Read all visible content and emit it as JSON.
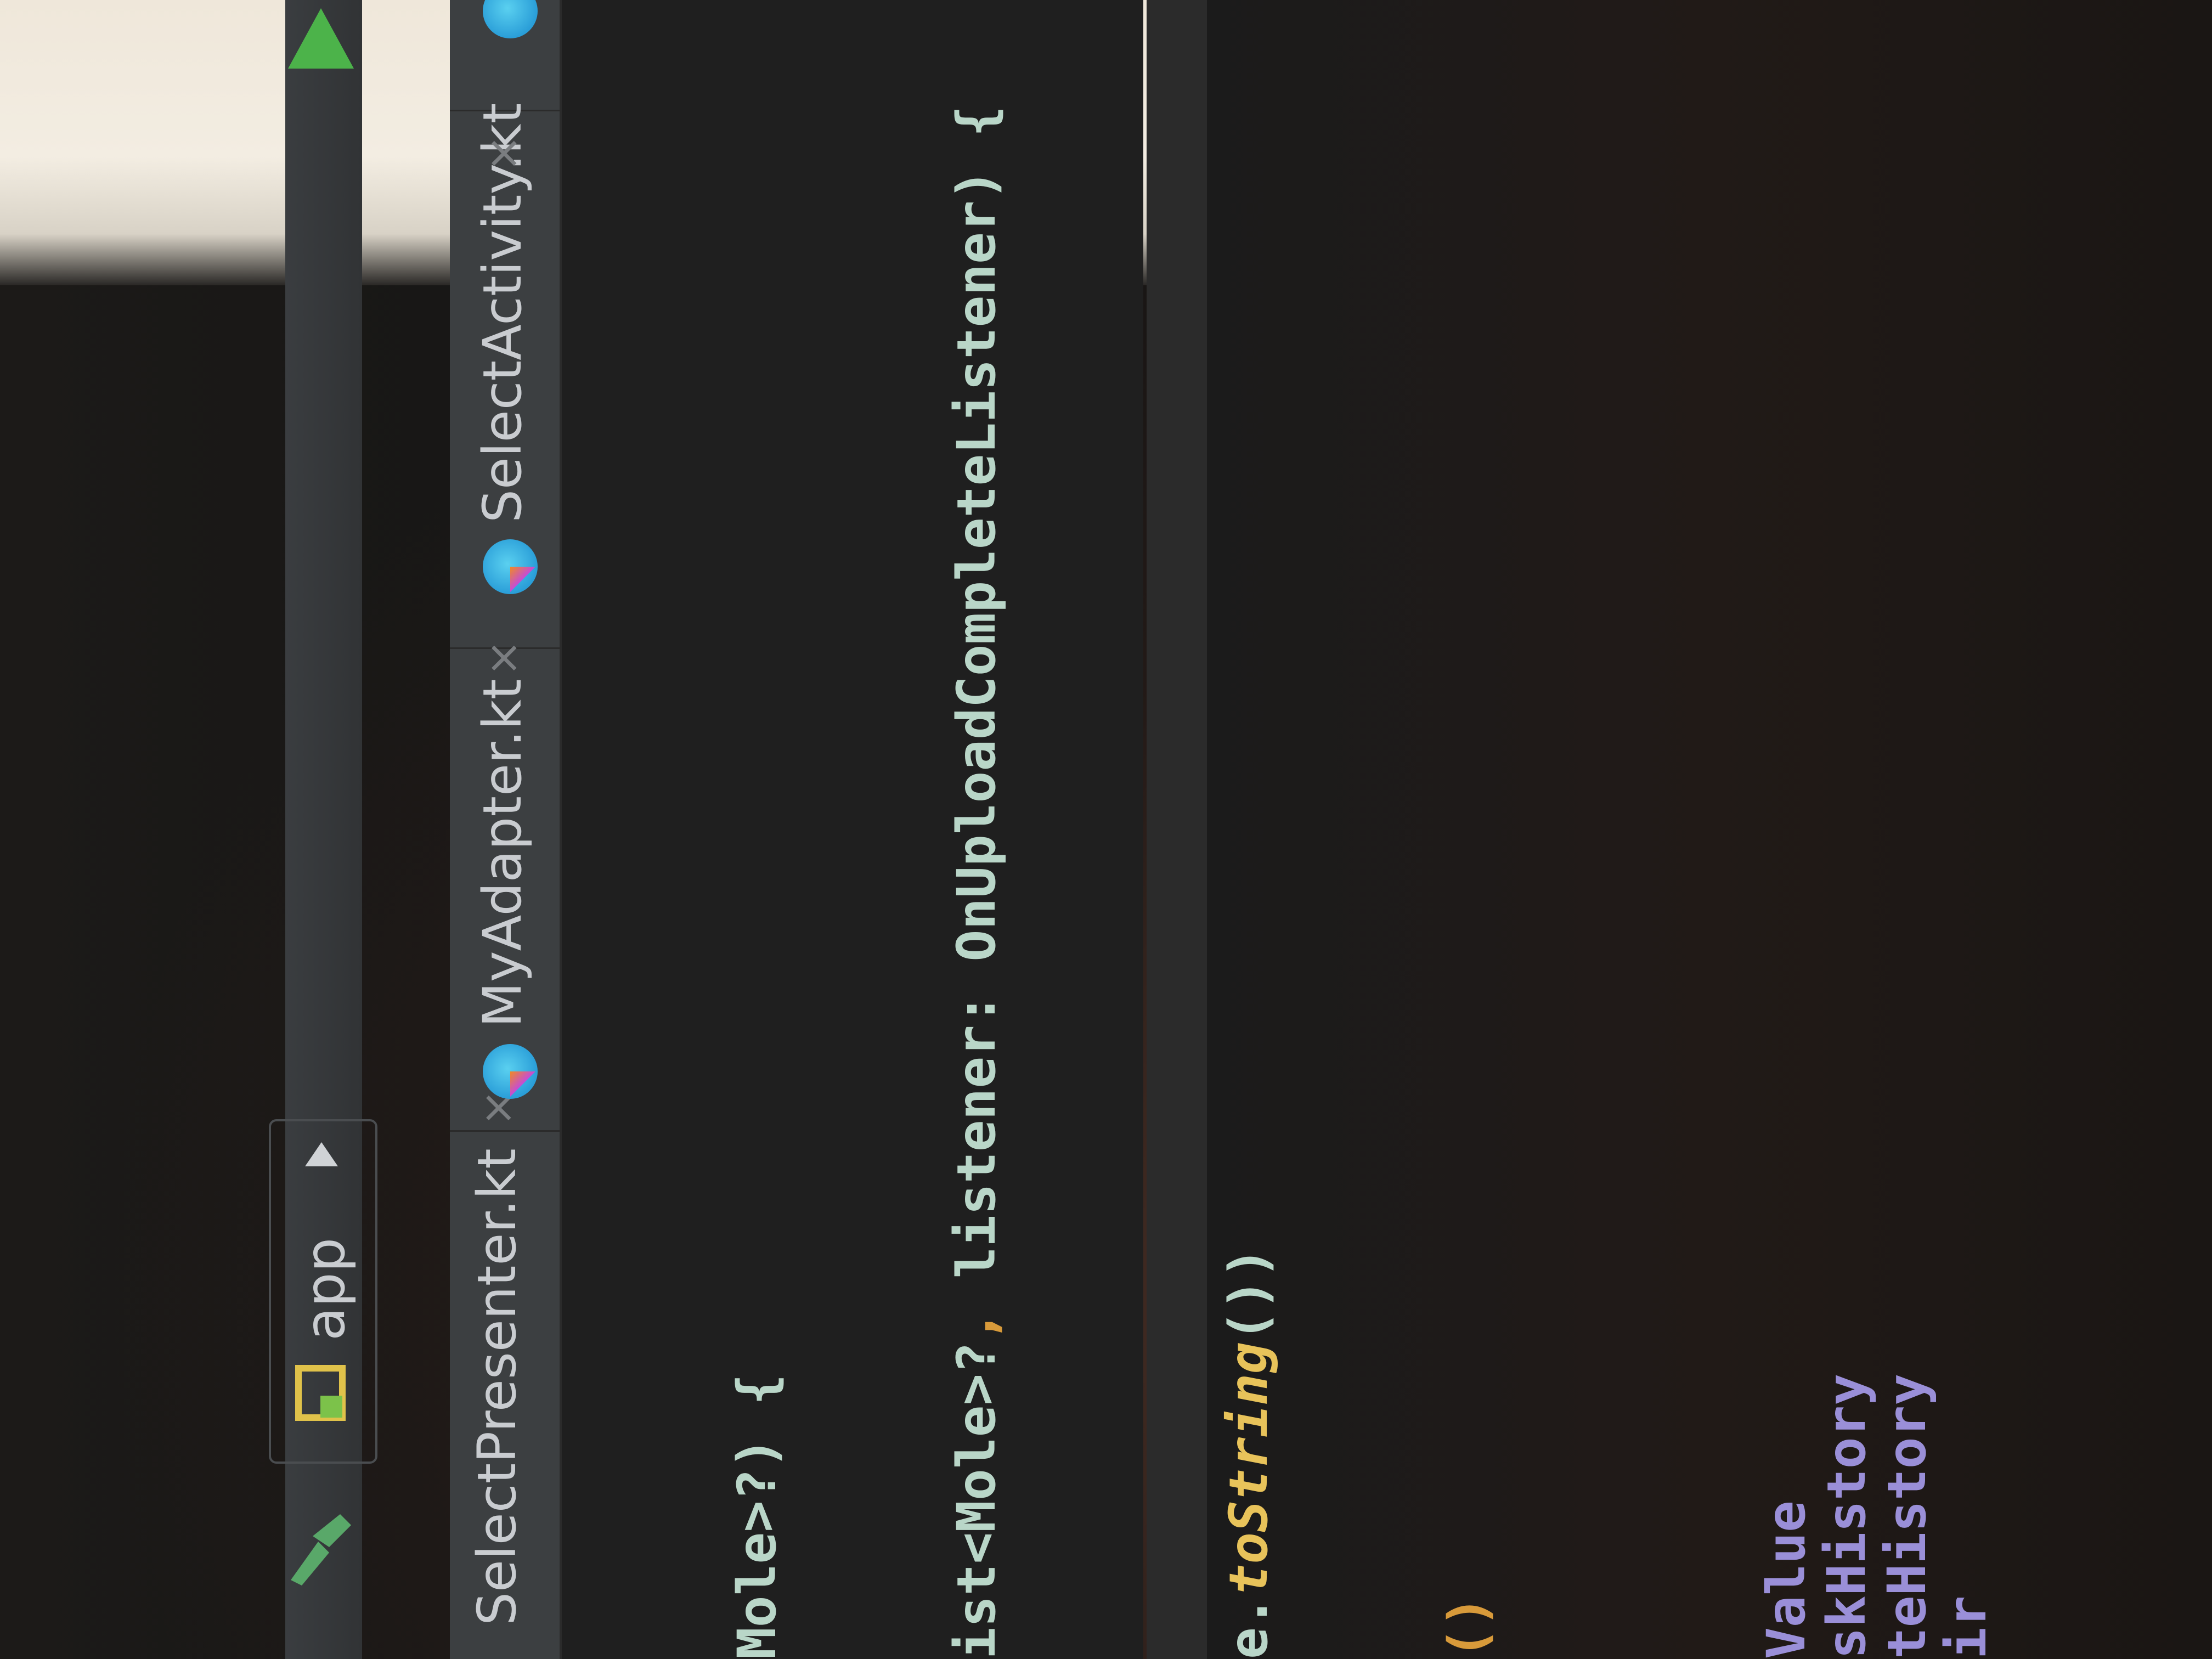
{
  "toolbar": {
    "run_config": "app",
    "dropdown_icon": "chevron-down-icon",
    "build_icon": "hammer-icon",
    "run_icon": "play-icon",
    "module_icon": "android-module-icon"
  },
  "tabs": [
    {
      "label": "SelectPresenter.kt",
      "close": "×",
      "icon": "kotlin-class-icon"
    },
    {
      "label": "MyAdapter.kt",
      "close": "×",
      "icon": "kotlin-class-icon"
    },
    {
      "label": "SelectActivity.kt",
      "close": "×",
      "icon": "kotlin-class-icon"
    }
  ],
  "code_upper": {
    "line1": "Mole>?) {",
    "line2_a": "ist<Mole>?",
    "line2_b": ",",
    "line2_c": " listener: OnUploadCompleteListener) {"
  },
  "code_lower": {
    "line1_a": "e.",
    "line1_fn": "toString",
    "line1_b": "())",
    "line2": "()",
    "line3": "Value",
    "line4": "skHistory",
    "line5": "teHistory",
    "line6": "ir"
  }
}
